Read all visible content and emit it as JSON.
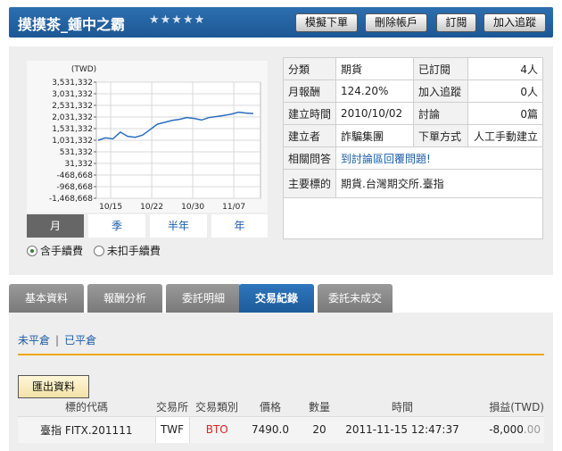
{
  "header": {
    "title": "摸摸茶_鍾中之霸",
    "rating_stars": "★★★★★",
    "buttons": {
      "simulate": "模擬下單",
      "delete": "刪除帳戶",
      "subscribe": "訂閱",
      "follow": "加入追蹤"
    }
  },
  "chart_data": {
    "type": "line",
    "ylabel": "(TWD)",
    "y_ticks": [
      "3,531,332",
      "3,031,332",
      "2,531,332",
      "2,031,332",
      "1,531,332",
      "1,031,332",
      "531,332",
      "31,332",
      "-468,668",
      "-968,668",
      "-1,468,668"
    ],
    "y_values": [
      3531332,
      3031332,
      2531332,
      2031332,
      1531332,
      1031332,
      531332,
      31332,
      -468668,
      -968668,
      -1468668
    ],
    "x_ticks": [
      "10/15",
      "10/22",
      "10/30",
      "11/07"
    ],
    "ylim": [
      -1468668,
      3531332
    ],
    "series": [
      {
        "values": [
          1031332,
          1130000,
          1090000,
          1380000,
          1200000,
          1160000,
          1250000,
          1480000,
          1720000,
          1800000,
          1880000,
          1930000,
          2010000,
          1970000,
          1900000,
          2010000,
          2050000,
          2100000,
          2150000,
          2240000,
          2200000,
          2180000
        ]
      }
    ],
    "grid": true
  },
  "period_tabs": [
    "月",
    "季",
    "半年",
    "年"
  ],
  "fee_options": {
    "with_fee": "含手續費",
    "without_fee": "未扣手續費"
  },
  "info": {
    "category_label": "分類",
    "category_value": "期貨",
    "subscribed_label": "已訂閱",
    "subscribed_value": "4人",
    "monthly_return_label": "月報酬",
    "monthly_return_value": "124.20%",
    "followed_label": "加入追蹤",
    "followed_value": "0人",
    "created_label": "建立時間",
    "created_value": "2010/10/02",
    "discussion_label": "討論",
    "discussion_value": "0篇",
    "creator_label": "建立者",
    "creator_value": "詐騙集團",
    "order_method_label": "下單方式",
    "order_method_value": "人工手動建立",
    "related_q_label": "相關問答",
    "related_q_link": "到討論區回覆問題!",
    "main_target_label": "主要標的",
    "main_target_value": "期貨.台灣期交所.臺指"
  },
  "main_tabs": [
    "基本資料",
    "報酬分析",
    "委託明細",
    "交易紀錄",
    "委託未成交"
  ],
  "subtabs": {
    "open": "未平倉",
    "sep": "|",
    "closed": "已平倉"
  },
  "export_label": "匯出資料",
  "trade_table": {
    "headers": [
      "標的代碼",
      "交易所",
      "交易類別",
      "價格",
      "數量",
      "時間",
      "損益(TWD)"
    ],
    "row": {
      "symbol": "臺指 FITX.201111",
      "exchange": "TWF",
      "type": "BTO",
      "price": "7490.0",
      "qty": "20",
      "time": "2011-11-15 12:47:37",
      "pnl_int": "-8,000",
      "pnl_dec": ".00"
    }
  },
  "colors": {
    "header_blue": "#1c5794",
    "accent_orange": "#f0a800",
    "link_blue": "#1a5ca8",
    "line": "#2a6ec0"
  }
}
